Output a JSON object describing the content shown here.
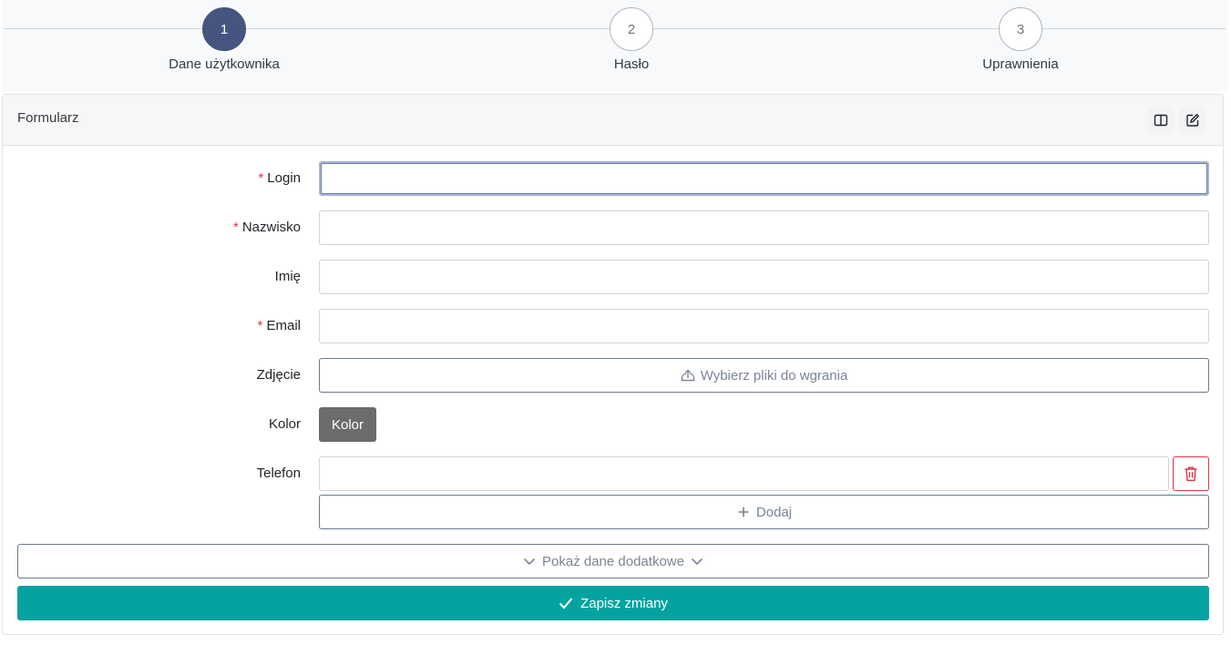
{
  "stepper": {
    "steps": [
      {
        "number": "1",
        "label": "Dane użytkownika",
        "state": "active"
      },
      {
        "number": "2",
        "label": "Hasło",
        "state": "inactive"
      },
      {
        "number": "3",
        "label": "Uprawnienia",
        "state": "inactive"
      }
    ]
  },
  "form": {
    "title": "Formularz",
    "header_icons": [
      "columns-icon",
      "edit-icon"
    ],
    "required_mark": "*",
    "fields": {
      "login": {
        "label": "Login",
        "value": "",
        "required": true
      },
      "nazwisko": {
        "label": "Nazwisko",
        "value": "",
        "required": true
      },
      "imie": {
        "label": "Imię",
        "value": "",
        "required": false
      },
      "email": {
        "label": "Email",
        "value": "",
        "required": true
      },
      "zdjecie": {
        "label": "Zdjęcie",
        "button": "Wybierz pliki do wgrania"
      },
      "kolor": {
        "label": "Kolor",
        "button": "Kolor"
      },
      "telefon": {
        "label": "Telefon",
        "value": "",
        "add_button": "Dodaj"
      }
    },
    "show_more": "Pokaż dane dodatkowe",
    "save": "Zapisz zmiany"
  },
  "colors": {
    "active_step": "#46557f",
    "save_button": "#04a3a0",
    "danger": "#dc3545",
    "color_button": "#6c6c6c"
  }
}
